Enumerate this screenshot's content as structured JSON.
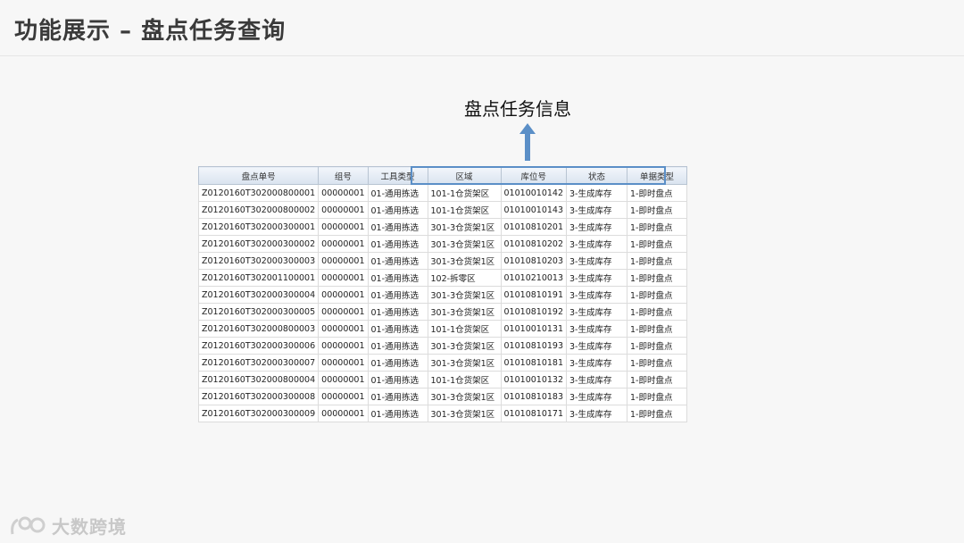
{
  "title": "功能展示 – 盘点任务查询",
  "annotation": "盘点任务信息",
  "watermark": "大数跨境",
  "colors": {
    "accent": "#5b8fc7",
    "arrow": "#5b8fc7"
  },
  "table": {
    "columns": [
      "盘点单号",
      "组号",
      "工具类型",
      "区域",
      "库位号",
      "状态",
      "单据类型"
    ],
    "rows": [
      [
        "Z0120160T302000800001",
        "00000001",
        "01-通用拣选",
        "101-1仓货架区",
        "01010010142",
        "3-生成库存",
        "1-即时盘点"
      ],
      [
        "Z0120160T302000800002",
        "00000001",
        "01-通用拣选",
        "101-1仓货架区",
        "01010010143",
        "3-生成库存",
        "1-即时盘点"
      ],
      [
        "Z0120160T302000300001",
        "00000001",
        "01-通用拣选",
        "301-3仓货架1区",
        "01010810201",
        "3-生成库存",
        "1-即时盘点"
      ],
      [
        "Z0120160T302000300002",
        "00000001",
        "01-通用拣选",
        "301-3仓货架1区",
        "01010810202",
        "3-生成库存",
        "1-即时盘点"
      ],
      [
        "Z0120160T302000300003",
        "00000001",
        "01-通用拣选",
        "301-3仓货架1区",
        "01010810203",
        "3-生成库存",
        "1-即时盘点"
      ],
      [
        "Z0120160T302001100001",
        "00000001",
        "01-通用拣选",
        "102-拆零区",
        "01010210013",
        "3-生成库存",
        "1-即时盘点"
      ],
      [
        "Z0120160T302000300004",
        "00000001",
        "01-通用拣选",
        "301-3仓货架1区",
        "01010810191",
        "3-生成库存",
        "1-即时盘点"
      ],
      [
        "Z0120160T302000300005",
        "00000001",
        "01-通用拣选",
        "301-3仓货架1区",
        "01010810192",
        "3-生成库存",
        "1-即时盘点"
      ],
      [
        "Z0120160T302000800003",
        "00000001",
        "01-通用拣选",
        "101-1仓货架区",
        "01010010131",
        "3-生成库存",
        "1-即时盘点"
      ],
      [
        "Z0120160T302000300006",
        "00000001",
        "01-通用拣选",
        "301-3仓货架1区",
        "01010810193",
        "3-生成库存",
        "1-即时盘点"
      ],
      [
        "Z0120160T302000300007",
        "00000001",
        "01-通用拣选",
        "301-3仓货架1区",
        "01010810181",
        "3-生成库存",
        "1-即时盘点"
      ],
      [
        "Z0120160T302000800004",
        "00000001",
        "01-通用拣选",
        "101-1仓货架区",
        "01010010132",
        "3-生成库存",
        "1-即时盘点"
      ],
      [
        "Z0120160T302000300008",
        "00000001",
        "01-通用拣选",
        "301-3仓货架1区",
        "01010810183",
        "3-生成库存",
        "1-即时盘点"
      ],
      [
        "Z0120160T302000300009",
        "00000001",
        "01-通用拣选",
        "301-3仓货架1区",
        "01010810171",
        "3-生成库存",
        "1-即时盘点"
      ]
    ]
  }
}
